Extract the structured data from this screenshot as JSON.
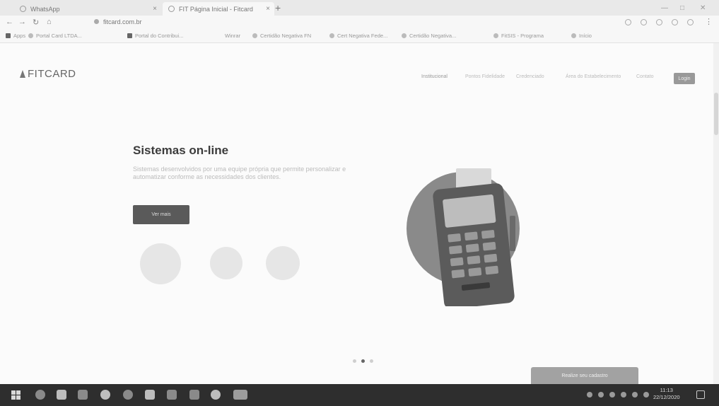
{
  "browser": {
    "tabs": [
      {
        "label": "WhatsApp"
      },
      {
        "label": "FIT Página Inicial - Fitcard"
      }
    ],
    "new_tab_symbol": "+",
    "url": "fitcard.com.br",
    "bookmarks": [
      {
        "label": "Apps"
      },
      {
        "label": "Portal Card LTDA..."
      },
      {
        "label": "Portal do Contribui..."
      },
      {
        "label": "Winrar"
      },
      {
        "label": "Certidão Negativa FN"
      },
      {
        "label": "Cert Negativa Fede..."
      },
      {
        "label": "Certidão Negativa..."
      },
      {
        "label": "FitSIS - Programa"
      },
      {
        "label": "Início"
      }
    ]
  },
  "site": {
    "logo_text": "FITCARD",
    "menu": [
      "Institucional",
      "Pontos Fidelidade",
      "Credenciado",
      "Área do Estabelecimento",
      "Contato"
    ],
    "login_label": "Login",
    "hero": {
      "title": "Sistemas on-line",
      "description": "Sistemas desenvolvidos por uma equipe própria que permite personalizar e automatizar conforme as necessidades dos clientes.",
      "button_label": "Ver mais"
    },
    "carousel": {
      "count": 3,
      "active_index": 1
    },
    "toast_label": "Realize seu cadastro"
  },
  "taskbar": {
    "time": "11:13",
    "date": "22/12/2020"
  },
  "colors": {
    "accent_button": "#5a5a5a",
    "taskbar": "#2e2e2e",
    "terminal_circle": "#8a8a8a"
  }
}
